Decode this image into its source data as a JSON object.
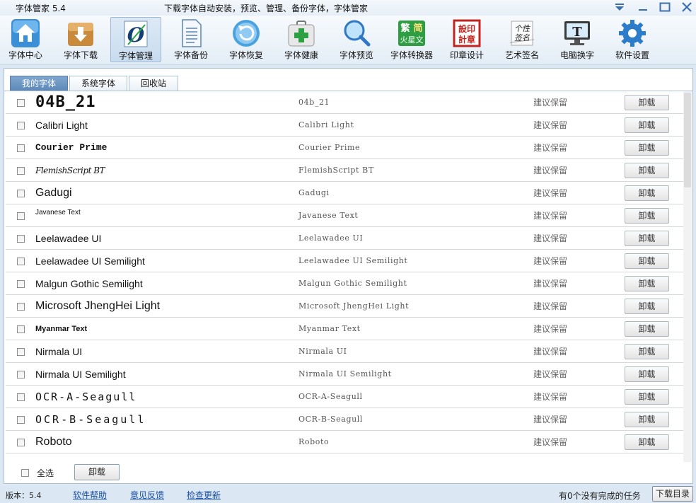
{
  "app": {
    "title": "字体管家 5.4",
    "slogan": "下载字体自动安装，预览、管理、备份字体，字体管家"
  },
  "toolbar": [
    {
      "label": "字体中心",
      "icon": "house-icon"
    },
    {
      "label": "字体下载",
      "icon": "download-box-icon"
    },
    {
      "label": "字体管理",
      "icon": "font-manage-icon"
    },
    {
      "label": "字体备份",
      "icon": "document-icon"
    },
    {
      "label": "字体恢复",
      "icon": "restore-icon"
    },
    {
      "label": "字体健康",
      "icon": "medkit-icon"
    },
    {
      "label": "字体预览",
      "icon": "magnifier-icon"
    },
    {
      "label": "字体转换器",
      "icon": "converter-icon",
      "glyphs": [
        "繁",
        "简",
        "火星文"
      ]
    },
    {
      "label": "印章设计",
      "icon": "seal-icon",
      "glyphs": [
        "設印",
        "計章"
      ]
    },
    {
      "label": "艺术签名",
      "icon": "signature-icon",
      "glyphs": [
        "个性",
        "签名"
      ]
    },
    {
      "label": "电脑换字",
      "icon": "monitor-icon",
      "glyphs": [
        "T"
      ]
    },
    {
      "label": "软件设置",
      "icon": "gear-icon"
    }
  ],
  "tabs": [
    "我的字体",
    "系统字体",
    "回收站"
  ],
  "fonts": [
    {
      "name": "04B_21",
      "note": "04b_21",
      "status": "建议保留",
      "action": "卸载"
    },
    {
      "name": "Calibri Light",
      "note": "Calibri Light",
      "status": "建议保留",
      "action": "卸载"
    },
    {
      "name": "Courier Prime",
      "note": "Courier Prime",
      "status": "建议保留",
      "action": "卸载"
    },
    {
      "name": "FlemishScript BT",
      "note": "FlemishScript BT",
      "status": "建议保留",
      "action": "卸载"
    },
    {
      "name": "Gadugi",
      "note": "Gadugi",
      "status": "建议保留",
      "action": "卸载"
    },
    {
      "name": "Javanese Text",
      "note": "Javanese Text",
      "status": "建议保留",
      "action": "卸载"
    },
    {
      "name": "Leelawadee UI",
      "note": "Leelawadee UI",
      "status": "建议保留",
      "action": "卸载"
    },
    {
      "name": "Leelawadee UI Semilight",
      "note": "Leelawadee UI Semilight",
      "status": "建议保留",
      "action": "卸载"
    },
    {
      "name": "Malgun Gothic Semilight",
      "note": "Malgun Gothic Semilight",
      "status": "建议保留",
      "action": "卸载"
    },
    {
      "name": "Microsoft JhengHei Light",
      "note": "Microsoft JhengHei Light",
      "status": "建议保留",
      "action": "卸载"
    },
    {
      "name": "Myanmar Text",
      "note": "Myanmar Text",
      "status": "建议保留",
      "action": "卸载"
    },
    {
      "name": "Nirmala UI",
      "note": "Nirmala UI",
      "status": "建议保留",
      "action": "卸载"
    },
    {
      "name": "Nirmala UI Semilight",
      "note": "Nirmala UI Semilight",
      "status": "建议保留",
      "action": "卸载"
    },
    {
      "name": "OCR-A-Seagull",
      "note": "OCR-A-Seagull",
      "status": "建议保留",
      "action": "卸载"
    },
    {
      "name": "OCR-B-Seagull",
      "note": "OCR-B-Seagull",
      "status": "建议保留",
      "action": "卸载"
    },
    {
      "name": "Roboto",
      "note": "Roboto",
      "status": "建议保留",
      "action": "卸载"
    }
  ],
  "bottom": {
    "select_all": "全选",
    "uninstall": "卸载"
  },
  "statusbar": {
    "version": "版本：5.4",
    "help": "软件帮助",
    "feedback": "意见反馈",
    "update": "检查更新",
    "tasks": "有0个没有完成的任务",
    "download_dir": "下载目录"
  }
}
